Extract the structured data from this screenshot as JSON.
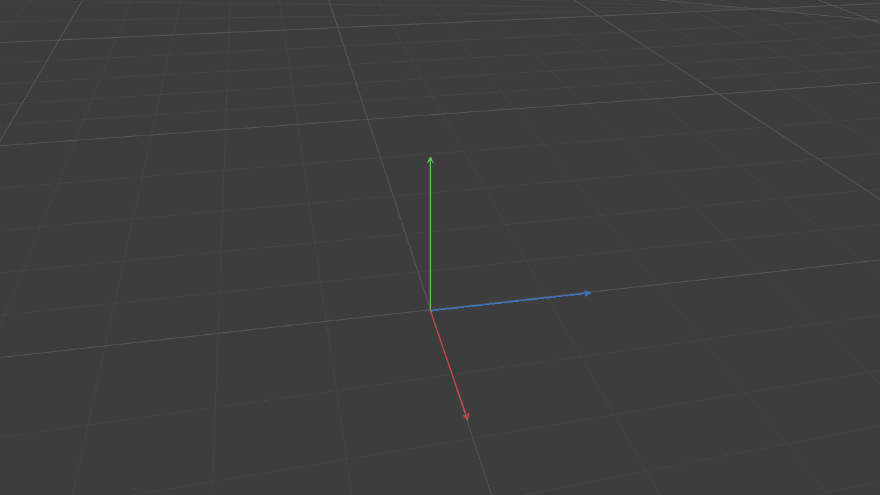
{
  "viewport": {
    "axes": [
      {
        "kind": "y",
        "color": "#5cc85c"
      },
      {
        "kind": "x",
        "color": "#3a78d0"
      },
      {
        "kind": "z",
        "color": "#c84848"
      }
    ]
  }
}
